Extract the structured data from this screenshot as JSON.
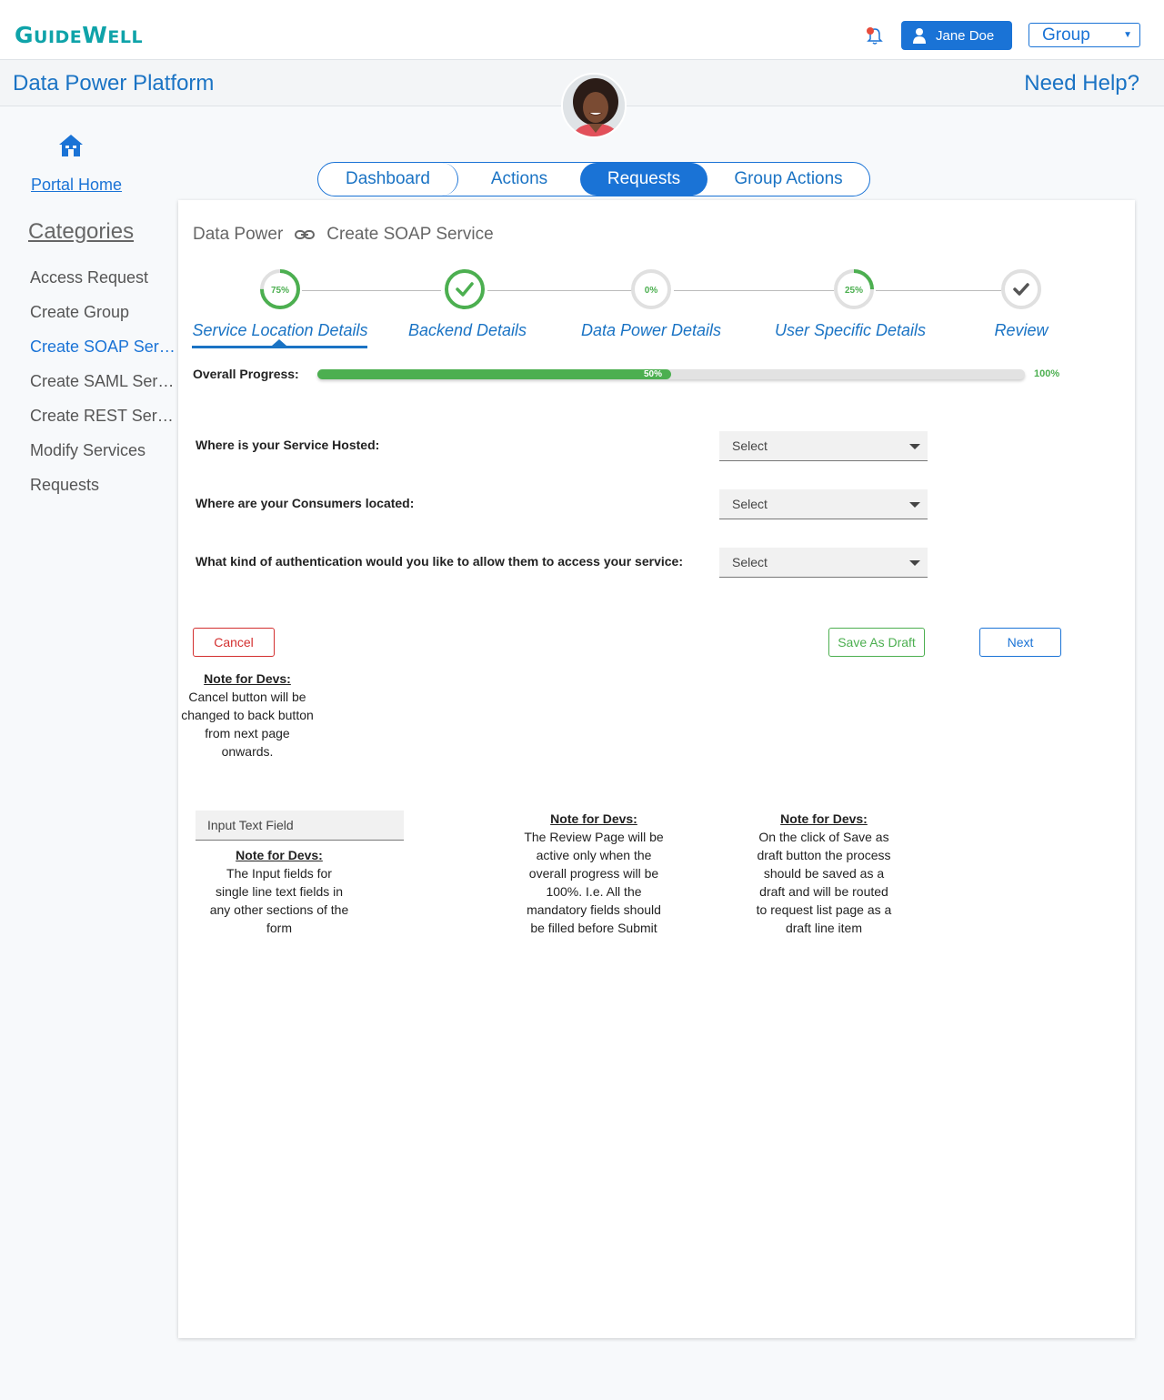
{
  "header": {
    "logo_main": "GUIDEWELL",
    "user_name": "Jane Doe",
    "group_value": "Group"
  },
  "titlebar": {
    "app_title": "Data Power Platform",
    "help": "Need Help?"
  },
  "sidebar": {
    "portal_home": "Portal Home",
    "categories_title": "Categories",
    "items": [
      {
        "label": "Access Request"
      },
      {
        "label": "Create Group"
      },
      {
        "label": "Create SOAP Servi..."
      },
      {
        "label": "Create SAML Servi..."
      },
      {
        "label": "Create REST Servi..."
      },
      {
        "label": "Modify Services"
      },
      {
        "label": "Requests"
      }
    ],
    "active_index": 2
  },
  "tabs": [
    {
      "label": "Dashboard"
    },
    {
      "label": "Actions"
    },
    {
      "label": "Requests"
    },
    {
      "label": "Group Actions"
    }
  ],
  "breadcrumb": {
    "root": "Data Power",
    "current": "Create SOAP Service"
  },
  "steps": [
    {
      "label": "Service Location Details",
      "progress_text": "75%",
      "progress": 0.75,
      "state": "partial"
    },
    {
      "label": "Backend Details",
      "progress_text": "",
      "progress": 1.0,
      "state": "complete"
    },
    {
      "label": "Data Power Details",
      "progress_text": "0%",
      "progress": 0.0,
      "state": "empty"
    },
    {
      "label": "User Specific Details",
      "progress_text": "25%",
      "progress": 0.25,
      "state": "partial"
    },
    {
      "label": "Review",
      "progress_text": "",
      "progress": 0.0,
      "state": "review"
    }
  ],
  "overall": {
    "label": "Overall Progress:",
    "value": 0.5,
    "value_text": "50%",
    "max_text": "100%"
  },
  "questions": [
    {
      "label": "Where is your Service Hosted:",
      "value": "Select"
    },
    {
      "label": "Where are your Consumers located:",
      "value": "Select"
    },
    {
      "label": "What kind of authentication would you like to allow them to access your service:",
      "value": "Select"
    }
  ],
  "buttons": {
    "cancel": "Cancel",
    "save_draft": "Save As Draft",
    "next": "Next"
  },
  "notes": {
    "cancel_note_title": "Note for Devs:",
    "cancel_note_lines": [
      "Cancel button will be",
      "changed to back button",
      "from next page onwards."
    ],
    "input_sample": "Input Text Field",
    "input_note_title": "Note for Devs:",
    "input_note_lines": [
      "The Input fields for",
      "single line text fields in",
      "any other sections of the",
      "form"
    ],
    "review_note_title": "Note for Devs:",
    "review_note_lines": [
      "The Review Page will be",
      "active only when the",
      "overall progress will be",
      "100%. I.e. All the",
      "mandatory fields should",
      "be filled before Submit"
    ],
    "draft_note_title": "Note for Devs:",
    "draft_note_lines": [
      "On the click of Save as",
      "draft button the process",
      "should be saved as a",
      "draft and will be routed",
      "to request list page as a",
      "draft line item"
    ]
  },
  "colors": {
    "primary": "#1a73d6",
    "success": "#4caf50",
    "danger": "#d32f2f",
    "logo": "#0fa3a9"
  }
}
